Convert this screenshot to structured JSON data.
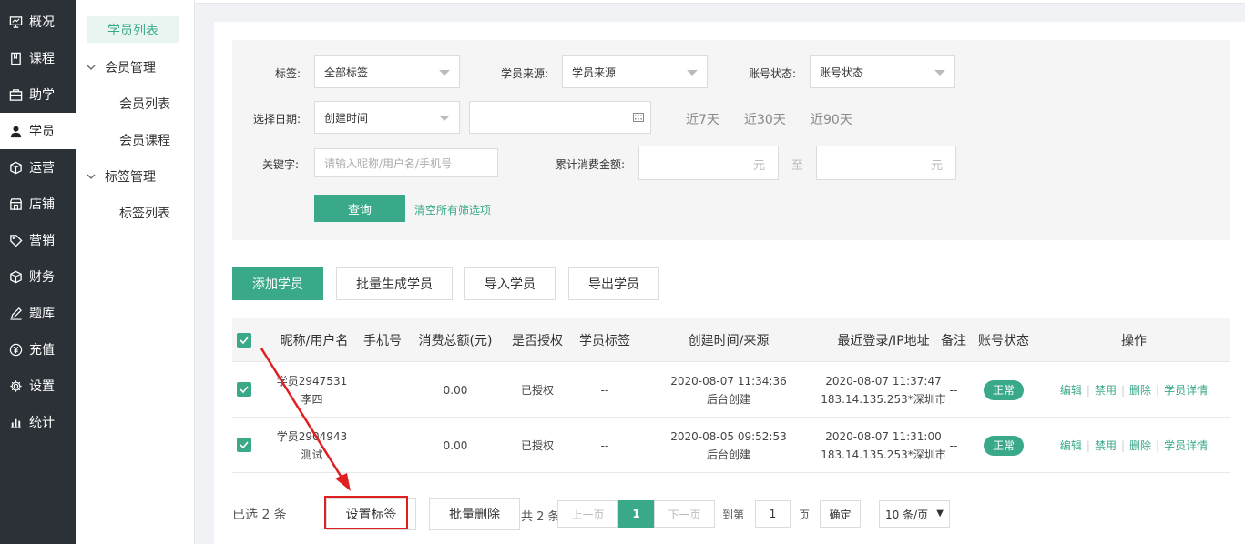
{
  "nav": {
    "items": [
      {
        "label": "概况",
        "icon": "overview-icon"
      },
      {
        "label": "课程",
        "icon": "course-icon"
      },
      {
        "label": "助学",
        "icon": "study-assist-icon"
      },
      {
        "label": "学员",
        "icon": "user-icon",
        "active": true
      },
      {
        "label": "运营",
        "icon": "operation-icon"
      },
      {
        "label": "店铺",
        "icon": "store-icon"
      },
      {
        "label": "营销",
        "icon": "tag-icon"
      },
      {
        "label": "财务",
        "icon": "finance-icon"
      },
      {
        "label": "题库",
        "icon": "pen-icon"
      },
      {
        "label": "充值",
        "icon": "yen-icon"
      },
      {
        "label": "设置",
        "icon": "gear-icon"
      },
      {
        "label": "统计",
        "icon": "bar-chart-icon"
      }
    ]
  },
  "subnav": {
    "active": "学员列表",
    "groups": [
      {
        "label": "会员管理",
        "items": [
          "会员列表",
          "会员课程"
        ]
      },
      {
        "label": "标签管理",
        "items": [
          "标签列表"
        ]
      }
    ]
  },
  "filter": {
    "tag_label": "标签:",
    "tag_value": "全部标签",
    "source_label": "学员来源:",
    "source_value": "学员来源",
    "status_label": "账号状态:",
    "status_value": "账号状态",
    "date_label": "选择日期:",
    "date_type_value": "创建时间",
    "date_range_value": "",
    "quick": [
      "近7天",
      "近30天",
      "近90天"
    ],
    "keyword_label": "关键字:",
    "keyword_placeholder": "请输入昵称/用户名/手机号",
    "amount_label": "累计消费金额:",
    "amount_unit": "元",
    "amount_to": "至",
    "query_button": "查询",
    "clear_link": "清空所有筛选项"
  },
  "actions": {
    "add": "添加学员",
    "batch_create": "批量生成学员",
    "import": "导入学员",
    "export": "导出学员"
  },
  "table": {
    "headers": [
      "昵称/用户名",
      "手机号",
      "消费总额(元)",
      "是否授权",
      "学员标签",
      "创建时间/来源",
      "最近登录/IP地址",
      "备注",
      "账号状态",
      "操作"
    ],
    "rows": [
      {
        "nickname": "学员2947531",
        "username": "李四",
        "phone": "",
        "total": "0.00",
        "authorized": "已授权",
        "tags": "--",
        "created": "2020-08-07 11:34:36",
        "source": "后台创建",
        "last_login": "2020-08-07 11:37:47",
        "ip": "183.14.135.253*深圳市",
        "remark": "--",
        "status": "正常",
        "ops": [
          "编辑",
          "禁用",
          "删除",
          "学员详情"
        ]
      },
      {
        "nickname": "学员2904943",
        "username": "测试",
        "phone": "",
        "total": "0.00",
        "authorized": "已授权",
        "tags": "--",
        "created": "2020-08-05 09:52:53",
        "source": "后台创建",
        "last_login": "2020-08-07 11:31:00",
        "ip": "183.14.135.253*深圳市",
        "remark": "--",
        "status": "正常",
        "ops": [
          "编辑",
          "禁用",
          "删除",
          "学员详情"
        ]
      }
    ]
  },
  "footer": {
    "selected": "已选 2 条",
    "set_tag": "设置标签",
    "batch_delete": "批量删除",
    "total": "共 2 条",
    "prev": "上一页",
    "page": "1",
    "next": "下一页",
    "goto": "到第",
    "goto_value": "1",
    "page_unit": "页",
    "confirm": "确定",
    "per_page": "10 条/页"
  },
  "colors": {
    "accent": "#3aa98a",
    "sidebar": "#2c3137",
    "highlight": "#e02020"
  }
}
